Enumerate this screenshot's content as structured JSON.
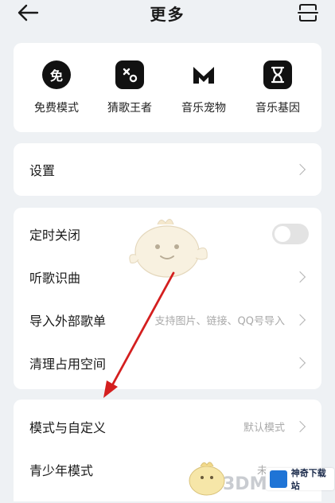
{
  "header": {
    "title": "更多"
  },
  "features": [
    {
      "label": "免费模式",
      "icon": "free-mode-icon",
      "glyph": "免"
    },
    {
      "label": "猜歌王者",
      "icon": "guess-song-icon"
    },
    {
      "label": "音乐宠物",
      "icon": "music-pet-icon"
    },
    {
      "label": "音乐基因",
      "icon": "music-gene-icon"
    }
  ],
  "settings": {
    "label": "设置"
  },
  "options": [
    {
      "label": "定时关闭"
    },
    {
      "label": "听歌识曲"
    },
    {
      "label": "导入外部歌单",
      "hint": "支持图片、链接、QQ号导入"
    },
    {
      "label": "清理占用空间"
    }
  ],
  "modes": [
    {
      "label": "模式与自定义",
      "hint": "默认模式"
    },
    {
      "label": "青少年模式",
      "hint": "未"
    }
  ],
  "watermark": {
    "brand": "神奇下载站",
    "site": "3DM"
  },
  "colors": {
    "background": "#eef1f4",
    "card": "#ffffff",
    "arrow": "#d41f1f",
    "icon": "#111111",
    "brand_blue": "#1f74d6"
  }
}
